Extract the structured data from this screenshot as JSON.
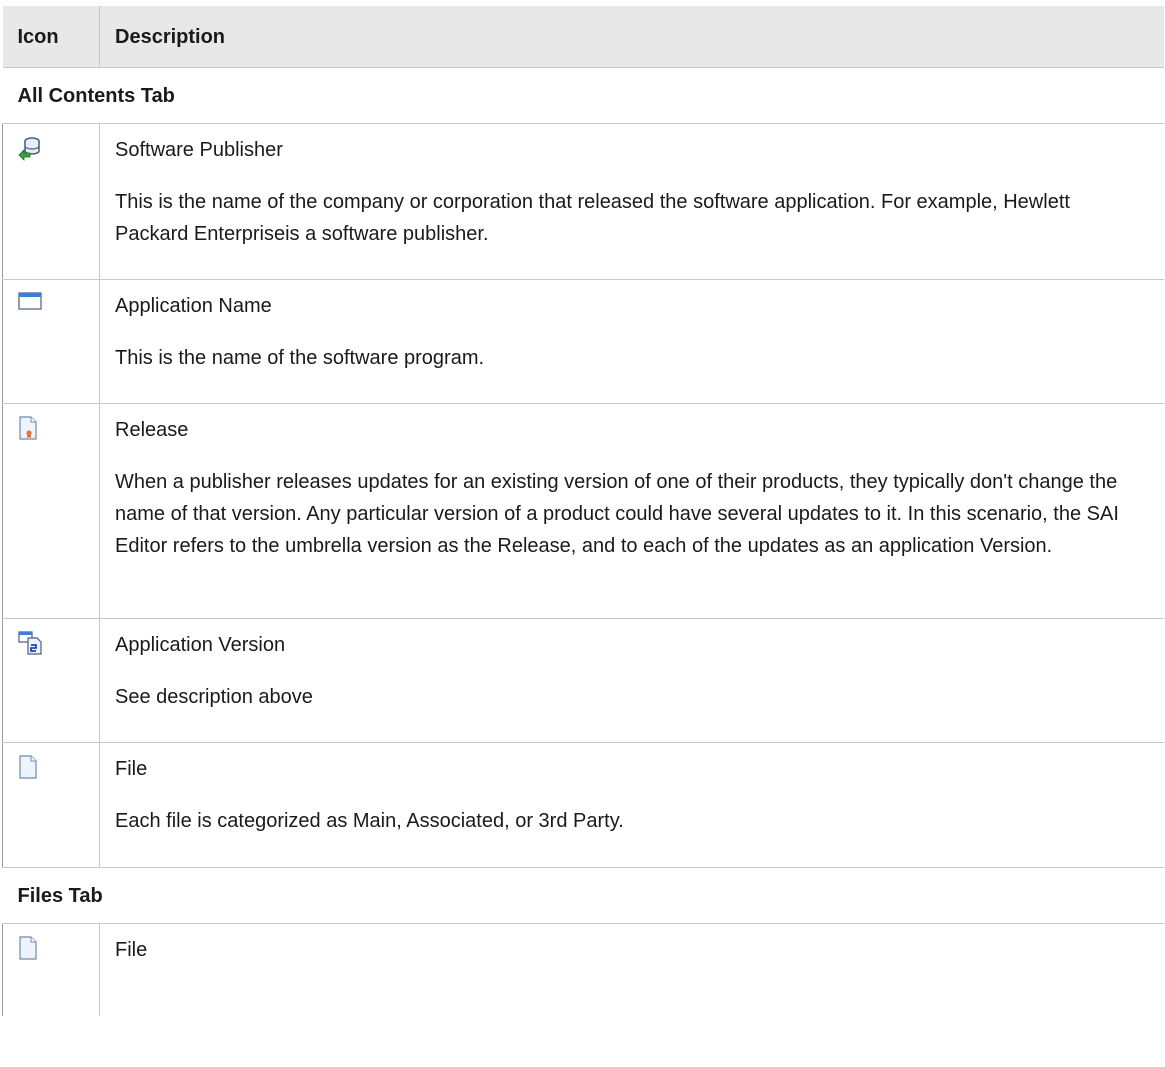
{
  "header": {
    "icon_col": "Icon",
    "desc_col": "Description"
  },
  "sections": [
    {
      "label": "All Contents Tab",
      "rows": [
        {
          "icon": "software-publisher-icon",
          "title": "Software Publisher",
          "description": "This is the name of the company or corporation that released the software application. For example, Hewlett Packard Enterpriseis a software publisher."
        },
        {
          "icon": "application-window-icon",
          "title": "Application Name",
          "description": "This is the name of the software program."
        },
        {
          "icon": "release-document-icon",
          "title": "Release",
          "description": "When a publisher releases updates for an existing version of one of their products, they typically don't change the name of that version. Any particular version of a product could have several updates to it. In this scenario, the SAI Editor refers to the umbrella version as the Release, and to each of the updates as an application Version."
        },
        {
          "icon": "application-version-icon",
          "title": "Application Version",
          "description": "See description above"
        },
        {
          "icon": "file-icon",
          "title": "File",
          "description": "Each file is categorized as Main, Associated, or 3rd Party."
        }
      ]
    },
    {
      "label": "Files Tab",
      "rows": [
        {
          "icon": "file-icon",
          "title": "File"
        }
      ]
    }
  ]
}
